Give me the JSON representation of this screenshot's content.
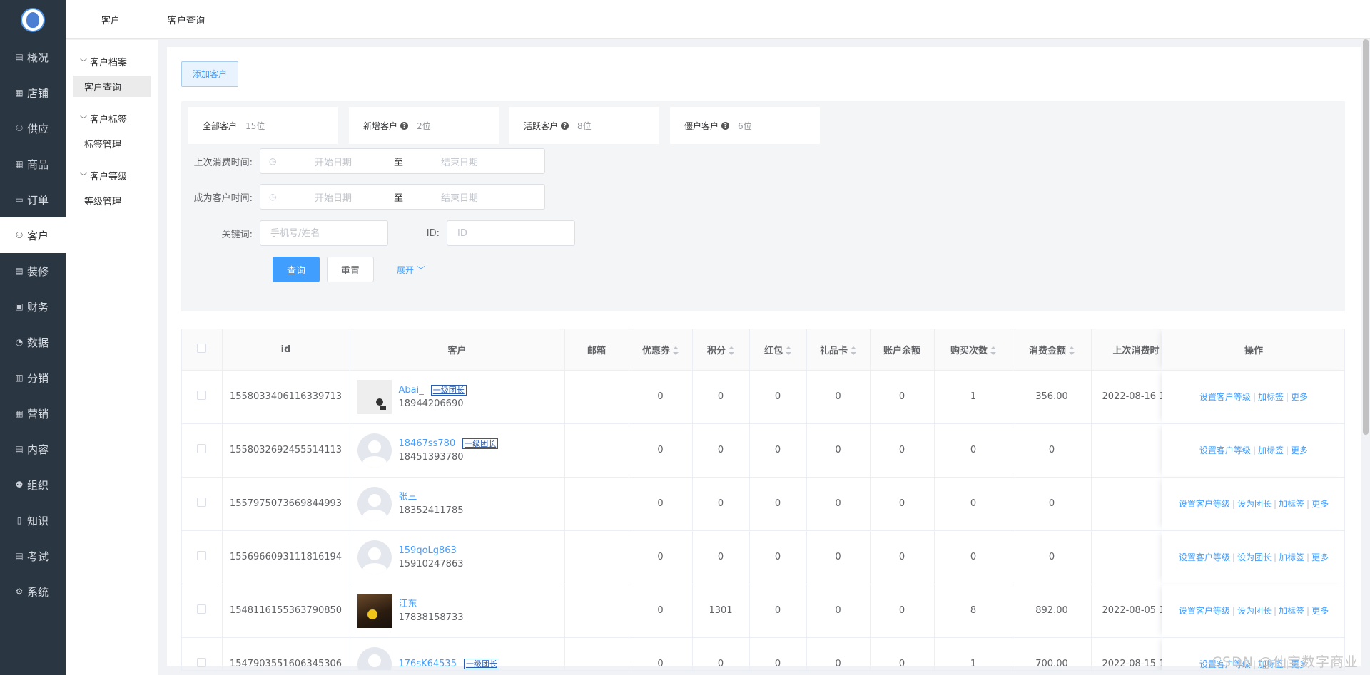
{
  "sidebar": {
    "items": [
      {
        "icon": "document-icon",
        "glyph": "▤",
        "label": "概况"
      },
      {
        "icon": "shop-icon",
        "glyph": "▦",
        "label": "店铺"
      },
      {
        "icon": "person-icon",
        "glyph": "⚇",
        "label": "供应"
      },
      {
        "icon": "grid-icon",
        "glyph": "▦",
        "label": "商品"
      },
      {
        "icon": "chat-icon",
        "glyph": "▭",
        "label": "订单"
      },
      {
        "icon": "user-icon",
        "glyph": "⚇",
        "label": "客户"
      },
      {
        "icon": "document-icon",
        "glyph": "▤",
        "label": "装修"
      },
      {
        "icon": "wallet-icon",
        "glyph": "▣",
        "label": "财务"
      },
      {
        "icon": "chart-icon",
        "glyph": "◔",
        "label": "数据"
      },
      {
        "icon": "trash-icon",
        "glyph": "▥",
        "label": "分销"
      },
      {
        "icon": "grid-icon",
        "glyph": "▦",
        "label": "营销"
      },
      {
        "icon": "edit-icon",
        "glyph": "▤",
        "label": "内容"
      },
      {
        "icon": "org-icon",
        "glyph": "⚉",
        "label": "组织"
      },
      {
        "icon": "book-icon",
        "glyph": "▯",
        "label": "知识"
      },
      {
        "icon": "exam-icon",
        "glyph": "▤",
        "label": "考试"
      },
      {
        "icon": "gear-icon",
        "glyph": "⚙",
        "label": "系统"
      }
    ],
    "active_index": 5
  },
  "topbar": {
    "tab1": "客户",
    "tab2": "客户查询"
  },
  "subnav": {
    "group1": "客户档案",
    "item1": "客户查询",
    "group2": "客户标签",
    "item2": "标签管理",
    "group3": "客户等级",
    "item3": "等级管理"
  },
  "actions": {
    "add_customer": "添加客户"
  },
  "stats": [
    {
      "label": "全部客户",
      "help": false,
      "value": "15位"
    },
    {
      "label": "新增客户",
      "help": true,
      "value": "2位"
    },
    {
      "label": "活跃客户",
      "help": true,
      "value": "8位"
    },
    {
      "label": "僵户客户",
      "help": true,
      "value": "6位"
    }
  ],
  "filters": {
    "last_consume_label": "上次消费时间:",
    "become_customer_label": "成为客户时间:",
    "start_placeholder": "开始日期",
    "range_separator": "至",
    "end_placeholder": "结束日期",
    "keyword_label": "关键词:",
    "keyword_placeholder": "手机号/姓名",
    "id_label": "ID:",
    "id_placeholder": "ID",
    "search_button": "查询",
    "reset_button": "重置",
    "expand_link": "展开"
  },
  "table": {
    "headers": {
      "id": "id",
      "customer": "客户",
      "email": "邮箱",
      "coupon": "优惠券",
      "points": "积分",
      "red_packet": "红包",
      "gift_card": "礼品卡",
      "balance": "账户余额",
      "buy_count": "购买次数",
      "amount": "消费金额",
      "last_consume": "上次消费时",
      "ops": "操作"
    },
    "rows": [
      {
        "id": "1558033406116339713",
        "avatar": "image",
        "name": "Abai_",
        "badge": "一级团长",
        "phone": "18944206690",
        "email": "",
        "coupon": "0",
        "points": "0",
        "red_packet": "0",
        "gift_card": "0",
        "balance": "0",
        "buy_count": "1",
        "amount": "356.00",
        "last_consume": "2022-08-16 1",
        "ops": [
          "设置客户等级",
          "加标签",
          "更多"
        ]
      },
      {
        "id": "1558032692455514113",
        "avatar": "default",
        "name": "18467ss780",
        "badge": "一级团长",
        "phone": "18451393780",
        "email": "",
        "coupon": "0",
        "points": "0",
        "red_packet": "0",
        "gift_card": "0",
        "balance": "0",
        "buy_count": "0",
        "amount": "0",
        "last_consume": "",
        "ops": [
          "设置客户等级",
          "加标签",
          "更多"
        ]
      },
      {
        "id": "1557975073669844993",
        "avatar": "default",
        "name": "张三",
        "badge": "",
        "phone": "18352411785",
        "email": "",
        "coupon": "0",
        "points": "0",
        "red_packet": "0",
        "gift_card": "0",
        "balance": "0",
        "buy_count": "0",
        "amount": "0",
        "last_consume": "",
        "ops": [
          "设置客户等级",
          "设为团长",
          "加标签",
          "更多"
        ]
      },
      {
        "id": "1556966093111816194",
        "avatar": "default",
        "name": "159qoLg863",
        "badge": "",
        "phone": "15910247863",
        "email": "",
        "coupon": "0",
        "points": "0",
        "red_packet": "0",
        "gift_card": "0",
        "balance": "0",
        "buy_count": "0",
        "amount": "0",
        "last_consume": "",
        "ops": [
          "设置客户等级",
          "设为团长",
          "加标签",
          "更多"
        ]
      },
      {
        "id": "1548116155363790850",
        "avatar": "photo",
        "name": "江东",
        "badge": "",
        "phone": "17838158733",
        "email": "",
        "coupon": "0",
        "points": "1301",
        "red_packet": "0",
        "gift_card": "0",
        "balance": "0",
        "buy_count": "8",
        "amount": "892.00",
        "last_consume": "2022-08-05 1",
        "ops": [
          "设置客户等级",
          "设为团长",
          "加标签",
          "更多"
        ]
      },
      {
        "id": "1547903551606345306",
        "avatar": "default",
        "name": "176sK64535",
        "badge": "一级团长",
        "phone": "",
        "email": "",
        "coupon": "0",
        "points": "0",
        "red_packet": "0",
        "gift_card": "0",
        "balance": "0",
        "buy_count": "1",
        "amount": "700.00",
        "last_consume": "2022-08-15 1",
        "ops": [
          "设置客户等级",
          "加标签",
          "更多"
        ]
      }
    ]
  },
  "watermark": "CSDN @仙宝数字商业"
}
